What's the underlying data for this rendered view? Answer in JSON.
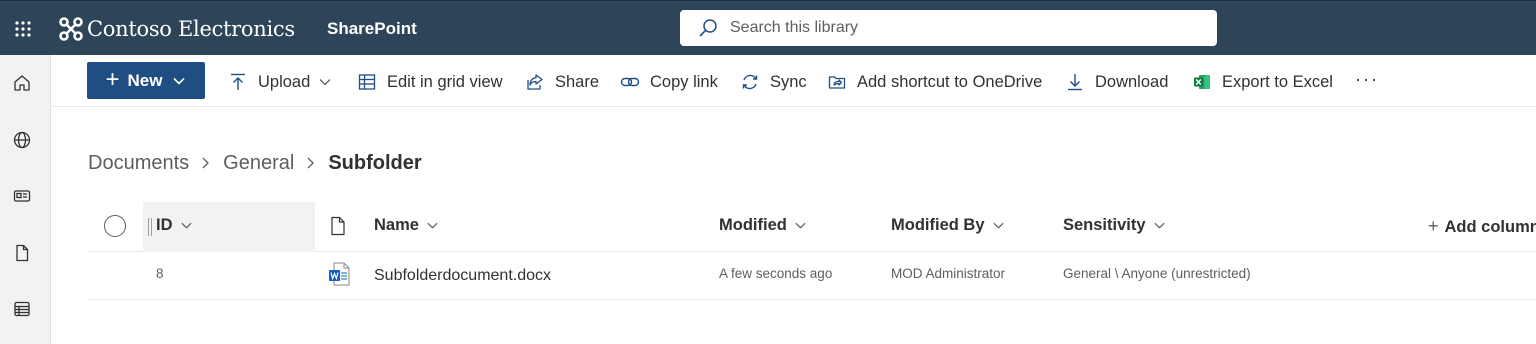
{
  "header": {
    "brand": "Contoso Electronics",
    "app": "SharePoint",
    "search_placeholder": "Search this library",
    "colors": {
      "bar": "#2e4458",
      "accent": "#1f4e83"
    }
  },
  "rail": {
    "items": [
      "home-icon",
      "globe-icon",
      "news-icon",
      "file-icon",
      "list-icon"
    ]
  },
  "toolbar": {
    "new_label": "New",
    "upload": "Upload",
    "edit_grid": "Edit in grid view",
    "share": "Share",
    "copy_link": "Copy link",
    "sync": "Sync",
    "add_shortcut": "Add shortcut to OneDrive",
    "download": "Download",
    "export_excel": "Export to Excel",
    "more": "···"
  },
  "breadcrumb": {
    "items": [
      "Documents",
      "General"
    ],
    "current": "Subfolder"
  },
  "list": {
    "columns": {
      "id": "ID",
      "name": "Name",
      "modified": "Modified",
      "modified_by": "Modified By",
      "sensitivity": "Sensitivity",
      "add_column": "Add column"
    },
    "rows": [
      {
        "id": "8",
        "name": "Subfolderdocument.docx",
        "modified": "A few seconds ago",
        "modified_by": "MOD Administrator",
        "sensitivity": "General \\ Anyone (unrestricted)"
      }
    ]
  }
}
